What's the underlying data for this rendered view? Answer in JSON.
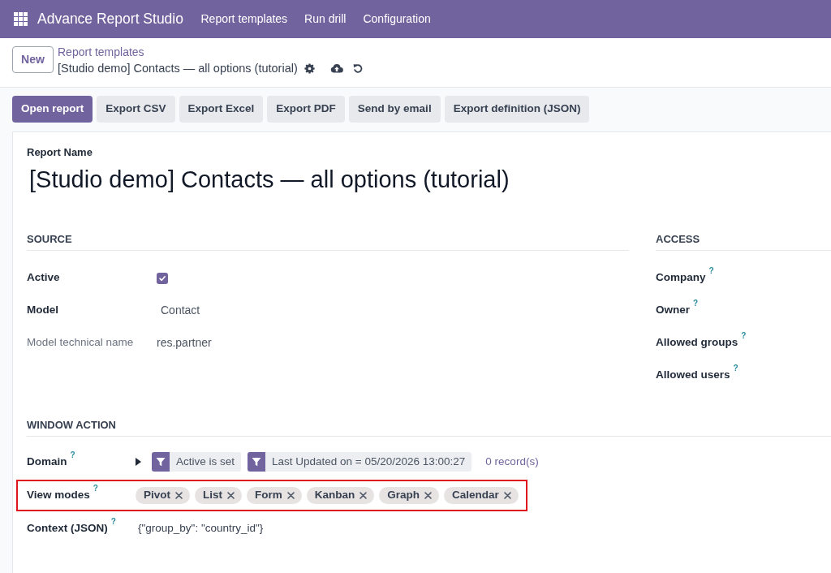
{
  "navbar": {
    "app_name": "Advance Report Studio",
    "menu": [
      {
        "label": "Report templates"
      },
      {
        "label": "Run drill"
      },
      {
        "label": "Configuration"
      }
    ]
  },
  "control_panel": {
    "new_button": "New",
    "breadcrumb_parent": "Report templates",
    "record_title": "[Studio demo] Contacts — all options (tutorial)"
  },
  "action_buttons": [
    {
      "label": "Open report",
      "primary": true
    },
    {
      "label": "Export CSV",
      "primary": false
    },
    {
      "label": "Export Excel",
      "primary": false
    },
    {
      "label": "Export PDF",
      "primary": false
    },
    {
      "label": "Send by email",
      "primary": false
    },
    {
      "label": "Export definition (JSON)",
      "primary": false
    }
  ],
  "form": {
    "name_label": "Report Name",
    "name": "[Studio demo] Contacts — all options (tutorial)",
    "groups": [
      {
        "title": "SOURCE",
        "fields": [
          {
            "label": "Active",
            "kind": "checkbox",
            "checked": true,
            "muted": false
          },
          {
            "label": "Model",
            "kind": "text",
            "value": "Contact",
            "muted": false
          },
          {
            "label": "Model technical name",
            "kind": "text",
            "value": "res.partner",
            "muted": true
          }
        ]
      },
      {
        "title": "ACCESS",
        "fields": [
          {
            "label": "Company",
            "help": "?",
            "kind": "blank",
            "muted": false
          },
          {
            "label": "Owner",
            "help": "?",
            "kind": "blank",
            "muted": false
          },
          {
            "label": "Allowed groups",
            "help": "?",
            "kind": "blank",
            "muted": false
          },
          {
            "label": "Allowed users",
            "help": "?",
            "kind": "blank",
            "muted": false
          }
        ]
      }
    ],
    "window_action": {
      "title": "WINDOW ACTION",
      "fields": [
        {
          "label": "Domain",
          "help": "?",
          "kind": "domain",
          "highlighted": false,
          "expanded": false,
          "filters": [
            {
              "label": "Active is set"
            },
            {
              "label": "Last Updated on = 05/20/2026 13:00:27"
            }
          ],
          "record_count": "0 record(s)"
        },
        {
          "label": "View modes",
          "help": "?",
          "kind": "tags",
          "highlighted": true,
          "tags": [
            {
              "label": "Pivot"
            },
            {
              "label": "List"
            },
            {
              "label": "Form"
            },
            {
              "label": "Kanban"
            },
            {
              "label": "Graph"
            },
            {
              "label": "Calendar"
            }
          ]
        },
        {
          "label": "Context (JSON)",
          "help": "?",
          "kind": "text",
          "highlighted": false,
          "value": "{\"group_by\": \"country_id\"}"
        }
      ]
    }
  }
}
